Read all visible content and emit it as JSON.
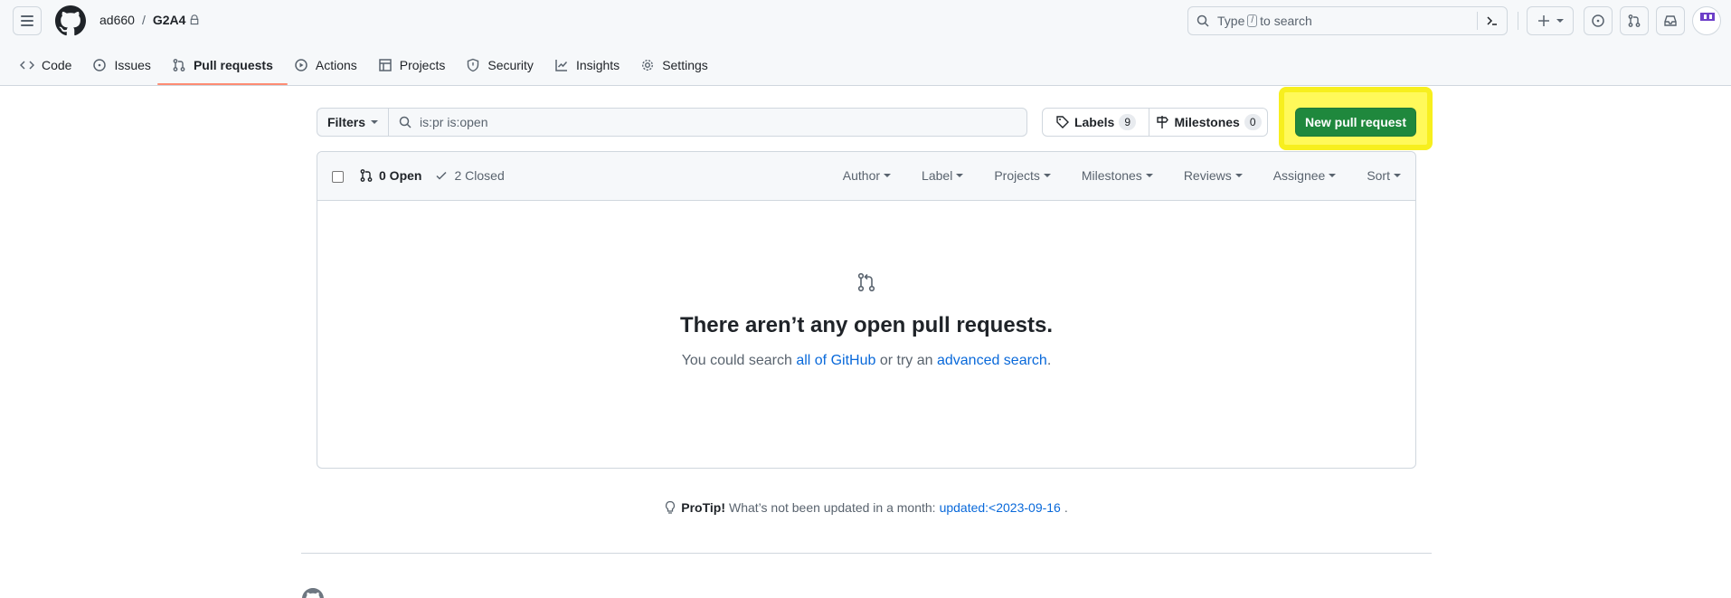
{
  "header": {
    "owner": "ad660",
    "separator": "/",
    "repo": "G2A4",
    "search_prefix": "Type",
    "search_key": "/",
    "search_suffix": "to search"
  },
  "nav": {
    "items": [
      {
        "label": "Code"
      },
      {
        "label": "Issues"
      },
      {
        "label": "Pull requests"
      },
      {
        "label": "Actions"
      },
      {
        "label": "Projects"
      },
      {
        "label": "Security"
      },
      {
        "label": "Insights"
      },
      {
        "label": "Settings"
      }
    ]
  },
  "toolbar": {
    "filters_label": "Filters",
    "search_value": "is:pr is:open",
    "labels_label": "Labels",
    "labels_count": "9",
    "milestones_label": "Milestones",
    "milestones_count": "0",
    "new_pr_label": "New pull request"
  },
  "list": {
    "open_label": "0 Open",
    "closed_label": "2 Closed",
    "filters": [
      "Author",
      "Label",
      "Projects",
      "Milestones",
      "Reviews",
      "Assignee",
      "Sort"
    ],
    "empty_title": "There aren’t any open pull requests.",
    "empty_prefix": "You could search",
    "empty_link1": "all of GitHub",
    "empty_mid": "or try an",
    "empty_link2": "advanced search",
    "empty_suffix": "."
  },
  "protip": {
    "label": "ProTip!",
    "text": "What’s not been updated in a month:",
    "link": "updated:<2023-09-16",
    "suffix": "."
  },
  "colors": {
    "primary_button": "#1f883d",
    "highlight": "#fff95a",
    "active_tab_underline": "#fd8c73",
    "link": "#0969da"
  }
}
